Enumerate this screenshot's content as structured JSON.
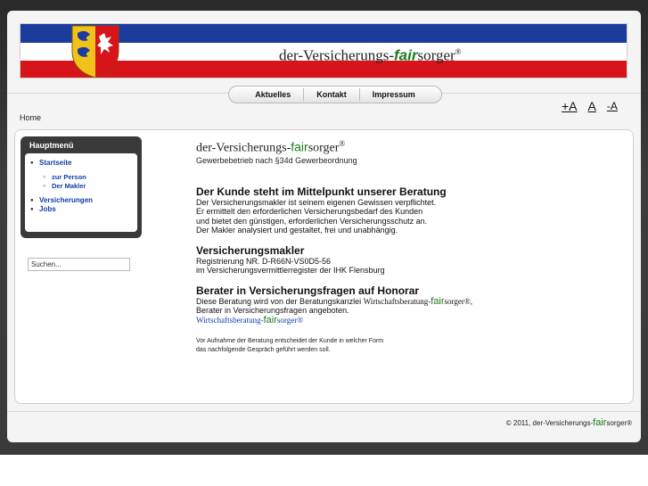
{
  "banner": {
    "title_pre": "der-Versicherungs-",
    "title_fair": "fair",
    "title_post": "sorger",
    "title_reg": "®",
    "colors": {
      "blue": "#1c3c9c",
      "white": "#ffffff",
      "red": "#d7141a"
    },
    "logo_icon": "coat-of-arms-icon"
  },
  "nav": {
    "items": [
      "Aktuelles",
      "Kontakt",
      "Impressum"
    ]
  },
  "font_size": {
    "increase": "+A",
    "reset": "A",
    "decrease": "-A"
  },
  "breadcrumb": "Home",
  "menu": {
    "title": "Hauptmenü",
    "items": [
      "Startseite",
      "zur Person",
      "Der Makler",
      "Versicherungen",
      "Jobs"
    ]
  },
  "search": {
    "placeholder": "Suchen..."
  },
  "main": {
    "sitename_pre": "der-Versicherungs-",
    "sitename_fair": "fair",
    "sitename_post": "sorger",
    "sitename_reg": "®",
    "subtitle": "Gewerbebetrieb nach §34d Gewerbeordnung",
    "h1": "Der Kunde steht im Mittelpunkt unserer Beratung",
    "p1": [
      "Der Versicherungsmakler ist seinem eigenen Gewissen verpflichtet.",
      "Er ermittelt den erforderlichen Versicherungsbedarf des Kunden",
      "und bietet den günstigen, erforderlichen Versicherungsschutz an.",
      "Der Makler analysiert und gestaltet, frei und unabhängig."
    ],
    "h2": "Versicherungsmakler",
    "p2": [
      "Registrierung NR. D-R66N-VS0D5-56",
      "im Versicherungsvermittlerregister der IHK Flensburg"
    ],
    "h3": "Berater in Versicherungsfragen auf Honorar",
    "p3_pre": "Diese Beratung wird von der Beratungskanzlei ",
    "p3_wb": "Wirtschaftsberatung-",
    "p3_fair": "fair",
    "p3_sorger": "sorger®",
    "p3_end": ",",
    "p3_line2": "Berater in Versicherungsfragen angeboten.",
    "link_pre": "Wirtschaftsberatung-",
    "link_fair": "fair",
    "link_post": "sorger®",
    "small": [
      "Vor Aufnahme der Beratung entscheidet der Kunde in welcher Form",
      "das nachfolgende Gespräch geführt werden soll."
    ]
  },
  "footer": {
    "pre": "© 2011, der-Versicherungs-",
    "fair": "fair",
    "post": "sorger®"
  }
}
